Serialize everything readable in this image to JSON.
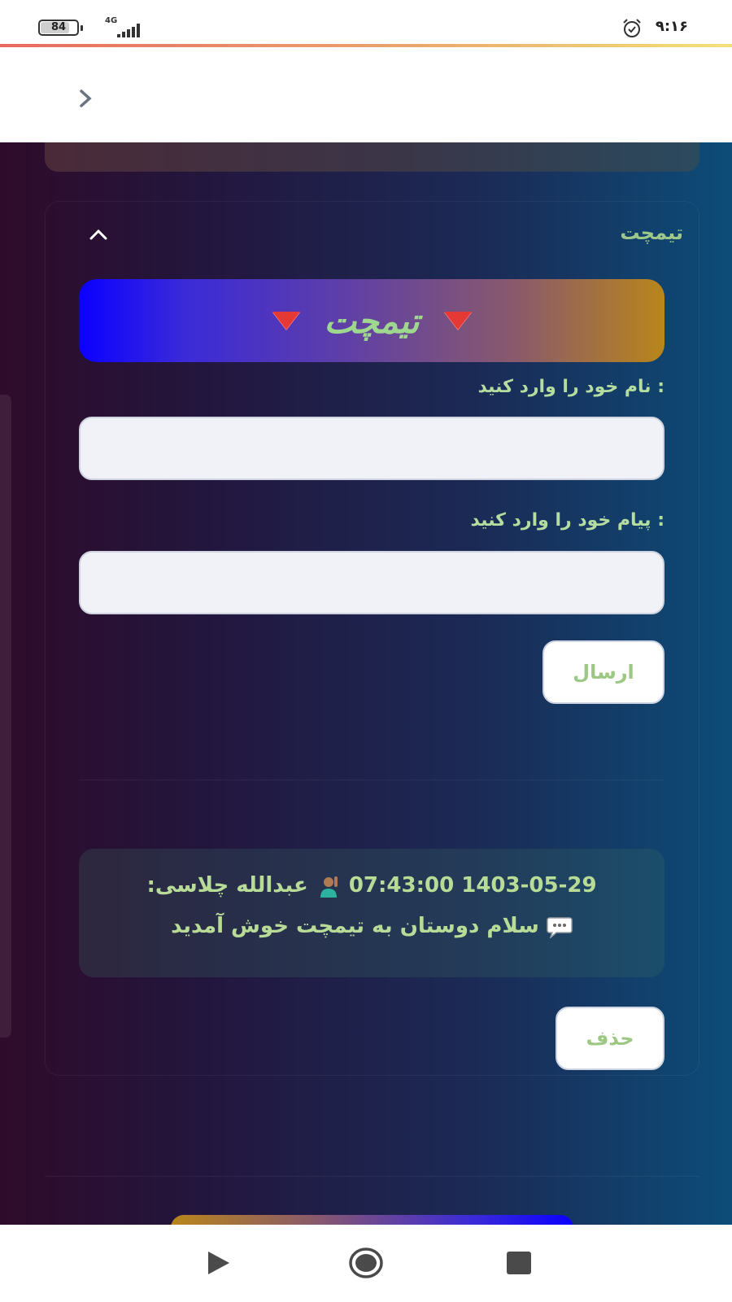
{
  "status_bar": {
    "time": "۹:۱۶",
    "battery": "84",
    "network": "4G",
    "battery_level": 0.84
  },
  "card": {
    "title": "تیمچت"
  },
  "banner": {
    "title": "تیمچت"
  },
  "form": {
    "name_label": ": نام خود را وارد کنید",
    "name_value": "",
    "message_label": ": پیام خود را وارد کنید",
    "message_value": "",
    "send_label": "ارسال",
    "delete_label": "حذف"
  },
  "messages": [
    {
      "header": "1403-05-29 07:43:00 🙋🏽‍♂️ عبدالله چلاسی:",
      "date": "1403-05-29",
      "time": "07:43:00",
      "author": "عبدالله چلاسی:",
      "text": "سلام دوستان به تیمچت خوش آمدید"
    }
  ],
  "colors": {
    "accent_text": "#9ec88a",
    "banner_start": "#0b00ff",
    "banner_end": "#b8861a"
  },
  "icons": [
    "back-chevron-icon",
    "collapse-chevron-icon",
    "triangle-icon",
    "raising-hand-icon",
    "speech-bubble-icon",
    "nav-back-icon",
    "nav-home-icon",
    "nav-recent-icon",
    "alarm-icon"
  ]
}
